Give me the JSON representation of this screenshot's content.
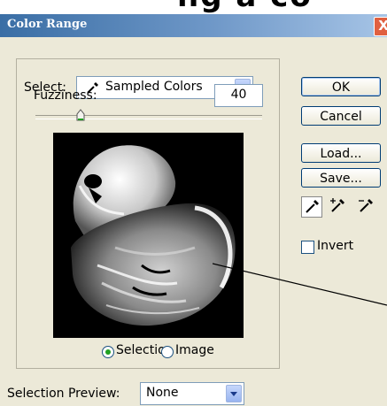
{
  "window": {
    "title": "Color Range",
    "close_glyph": "X"
  },
  "top_strip_text": "ng a co",
  "select": {
    "label": "Select:",
    "value": "Sampled Colors",
    "icon": "eyedropper-icon"
  },
  "fuzziness": {
    "label": "Fuzziness:",
    "value": "40",
    "slider_level": 0.2
  },
  "preview_mode": {
    "selection_label": "Selection",
    "image_label": "Image",
    "selected": "Selection"
  },
  "buttons": {
    "ok": "OK",
    "cancel": "Cancel",
    "load": "Load...",
    "save": "Save..."
  },
  "eyedroppers": [
    "eyedropper-icon",
    "eyedropper-plus-icon",
    "eyedropper-minus-icon"
  ],
  "invert": {
    "label": "Invert",
    "checked": false
  },
  "selection_preview": {
    "label": "Selection Preview:",
    "value": "None"
  },
  "colors": {
    "titlebar_start": "#3a6ea5",
    "titlebar_end": "#a6c4e6",
    "dialog_bg": "#ece9d8",
    "radio_dot": "#21a121"
  }
}
